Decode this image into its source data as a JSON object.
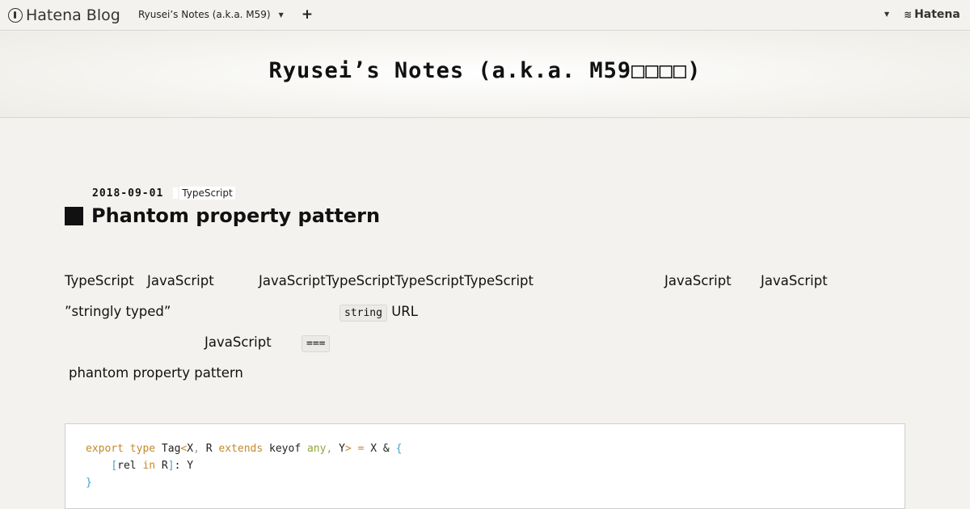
{
  "globalbar": {
    "logo_text": "Hatena Blog",
    "blog_switch_label": "Ryusei’s Notes (a.k.a. M59)",
    "add_label": "+",
    "brand_text": "Hatena"
  },
  "blog": {
    "title": "Ryusei’s Notes (a.k.a. M59□□□□)"
  },
  "entry": {
    "date": "2018-09-01",
    "category": "TypeScript",
    "title": "Phantom property pattern",
    "paragraph1": [
      "TypeScript",
      "JavaScript",
      "JavaScriptTypeScriptTypeScriptTypeScript",
      "JavaScript",
      "JavaScript"
    ],
    "paragraph2": {
      "quote": "”stringly typed”",
      "code": "string",
      "after": "URL"
    },
    "paragraph3": {
      "word": "JavaScript",
      "code": "==="
    },
    "paragraph4": "phantom property pattern",
    "code_lines": [
      "export type Tag<X, R extends keyof any, Y> = X & {",
      "    [rel in R]: Y",
      "}"
    ]
  },
  "colors": {
    "background": "#f3f2ee",
    "keyword": "#c28a2d",
    "type": "#8fa83a",
    "bracket": "#42a6c9"
  }
}
